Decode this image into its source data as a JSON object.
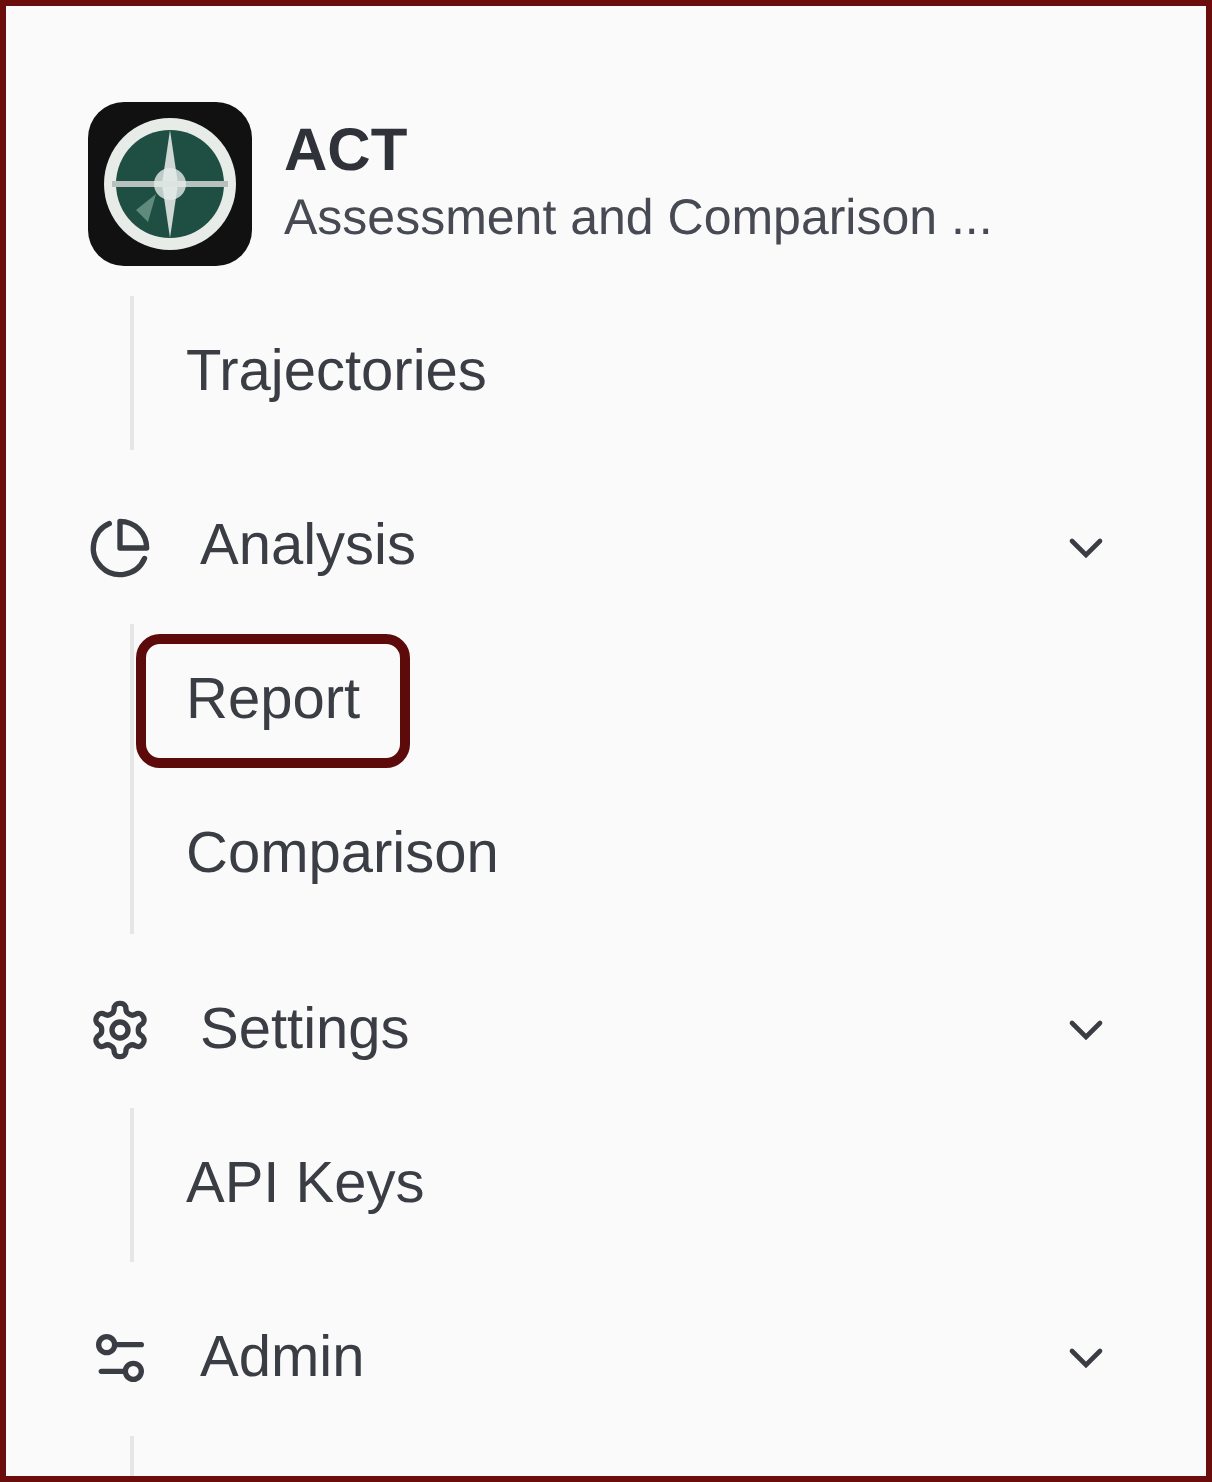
{
  "app": {
    "title": "ACT",
    "subtitle": "Assessment and Comparison ..."
  },
  "nav": [
    {
      "children": [
        {
          "label": "Trajectories",
          "highlighted": false
        }
      ]
    },
    {
      "label": "Analysis",
      "kind": "pie",
      "expanded": true,
      "children": [
        {
          "label": "Report",
          "highlighted": true
        },
        {
          "label": "Comparison",
          "highlighted": false
        }
      ]
    },
    {
      "label": "Settings",
      "kind": "gear",
      "expanded": true,
      "children": [
        {
          "label": "API Keys",
          "highlighted": false
        }
      ]
    },
    {
      "label": "Admin",
      "kind": "sliders",
      "expanded": true
    }
  ]
}
